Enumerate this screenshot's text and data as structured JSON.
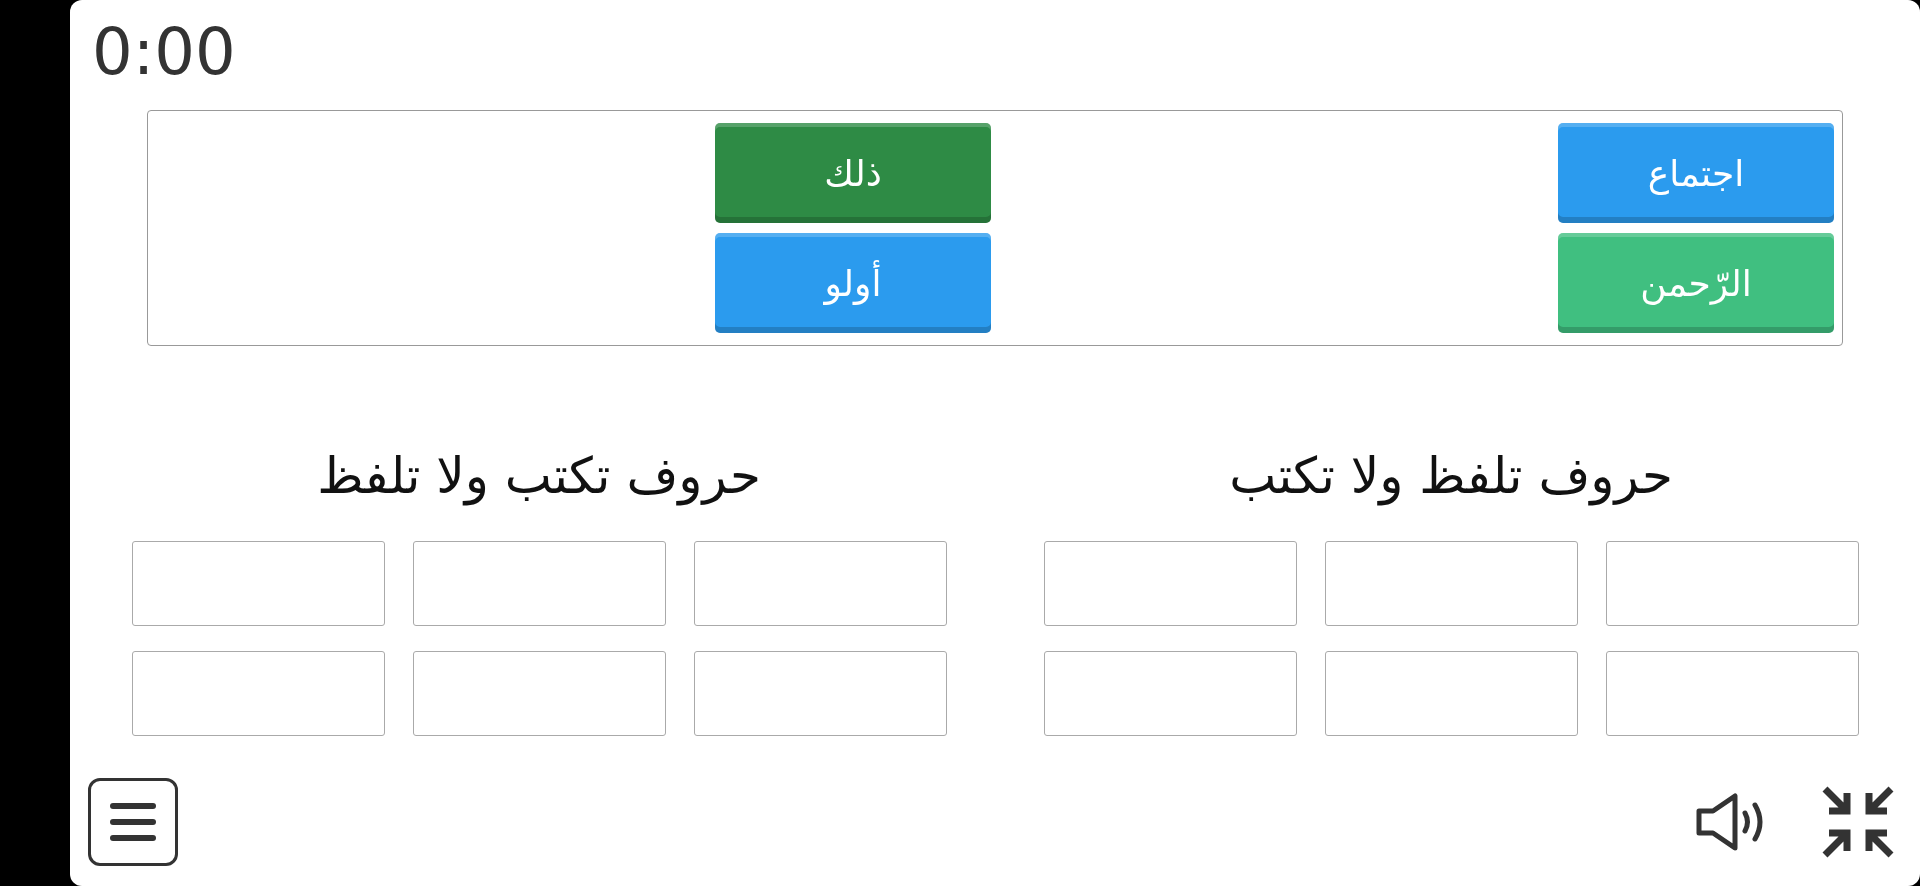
{
  "timer": "0:00",
  "tiles": [
    {
      "label": "اجتماع",
      "color": "#2b9bee"
    },
    {
      "label": "الرّحمن",
      "color": "#40bf80"
    },
    {
      "label": "ذلك",
      "color": "#2e8b45"
    },
    {
      "label": "أولو",
      "color": "#2b9bee"
    }
  ],
  "groups": [
    {
      "title": "حروف تلفظ ولا تكتب",
      "slots": [
        {
          "filled": false
        },
        {
          "filled": false
        },
        {
          "filled": false
        },
        {
          "filled": false
        },
        {
          "filled": false
        },
        {
          "filled": false
        }
      ]
    },
    {
      "title": "حروف تكتب ولا تلفظ",
      "slots": [
        {
          "filled": false
        },
        {
          "filled": false
        },
        {
          "filled": false
        },
        {
          "filled": false
        },
        {
          "filled": false
        },
        {
          "filled": false
        }
      ]
    }
  ]
}
